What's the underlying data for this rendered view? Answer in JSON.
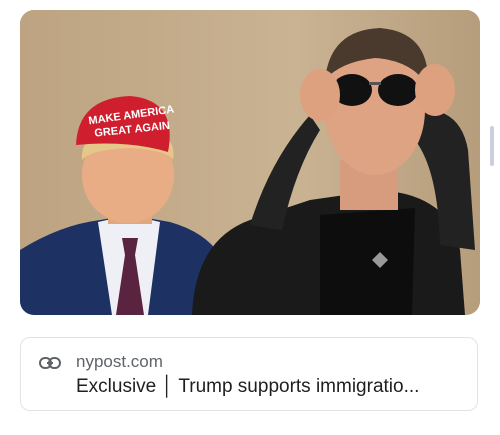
{
  "image": {
    "alt": ""
  },
  "link_card": {
    "domain": "nypost.com",
    "title": "Exclusive │ Trump supports immigratio...",
    "icon": "link-icon"
  },
  "colors": {
    "card_border": "#e3e3e3",
    "domain_text": "#5f6368",
    "title_text": "#1f1f1f",
    "scrollbar": "#c9cfe0"
  }
}
